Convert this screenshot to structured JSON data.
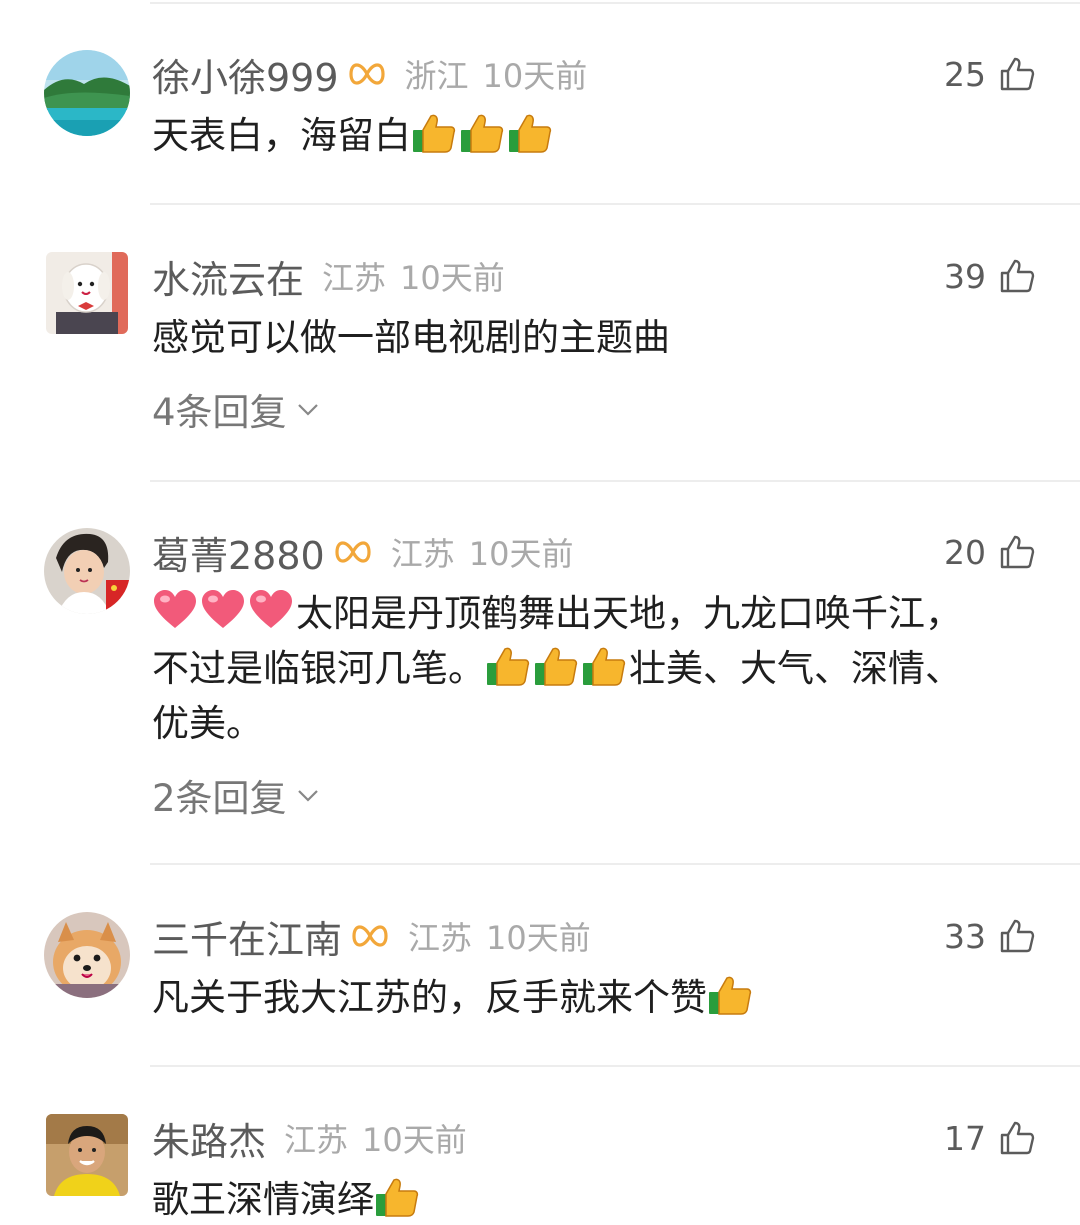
{
  "comments": [
    {
      "name": "徐小徐999",
      "vip": true,
      "location": "浙江",
      "time": "10天前",
      "likes": "25",
      "text_parts": [
        "天表白，海留白"
      ],
      "trailing_thumbs": 3
    },
    {
      "name": "水流云在",
      "vip": false,
      "location": "江苏",
      "time": "10天前",
      "likes": "39",
      "text": "感觉可以做一部电视剧的主题曲",
      "replies": "4条回复"
    },
    {
      "name": "葛菁2880",
      "vip": true,
      "location": "江苏",
      "time": "10天前",
      "likes": "20",
      "line1": "太阳是丹顶鹤舞出天地，九龙口唤千江，",
      "line2a": "不过是临银河几笔。",
      "line2b": "壮美、大气、深情、",
      "line3": "优美。",
      "replies": "2条回复"
    },
    {
      "name": "三千在江南",
      "vip": true,
      "location": "江苏",
      "time": "10天前",
      "likes": "33",
      "text": "凡关于我大江苏的，反手就来个赞"
    },
    {
      "name": "朱路杰",
      "vip": false,
      "location": "江苏",
      "time": "10天前",
      "likes": "17",
      "text": "歌王深情演绎"
    }
  ],
  "icons": {
    "like": "thumb-up-outline-icon",
    "vip": "vip-infinity-badge-icon",
    "emoji_thumb": "thumbs-up-emoji",
    "emoji_heart": "heart-emoji",
    "expand": "chevron-down-icon"
  },
  "colors": {
    "name": "#5b5b5b",
    "meta": "#a9a9a9",
    "text": "#1f1f1f",
    "vip": "#f2a73a"
  }
}
